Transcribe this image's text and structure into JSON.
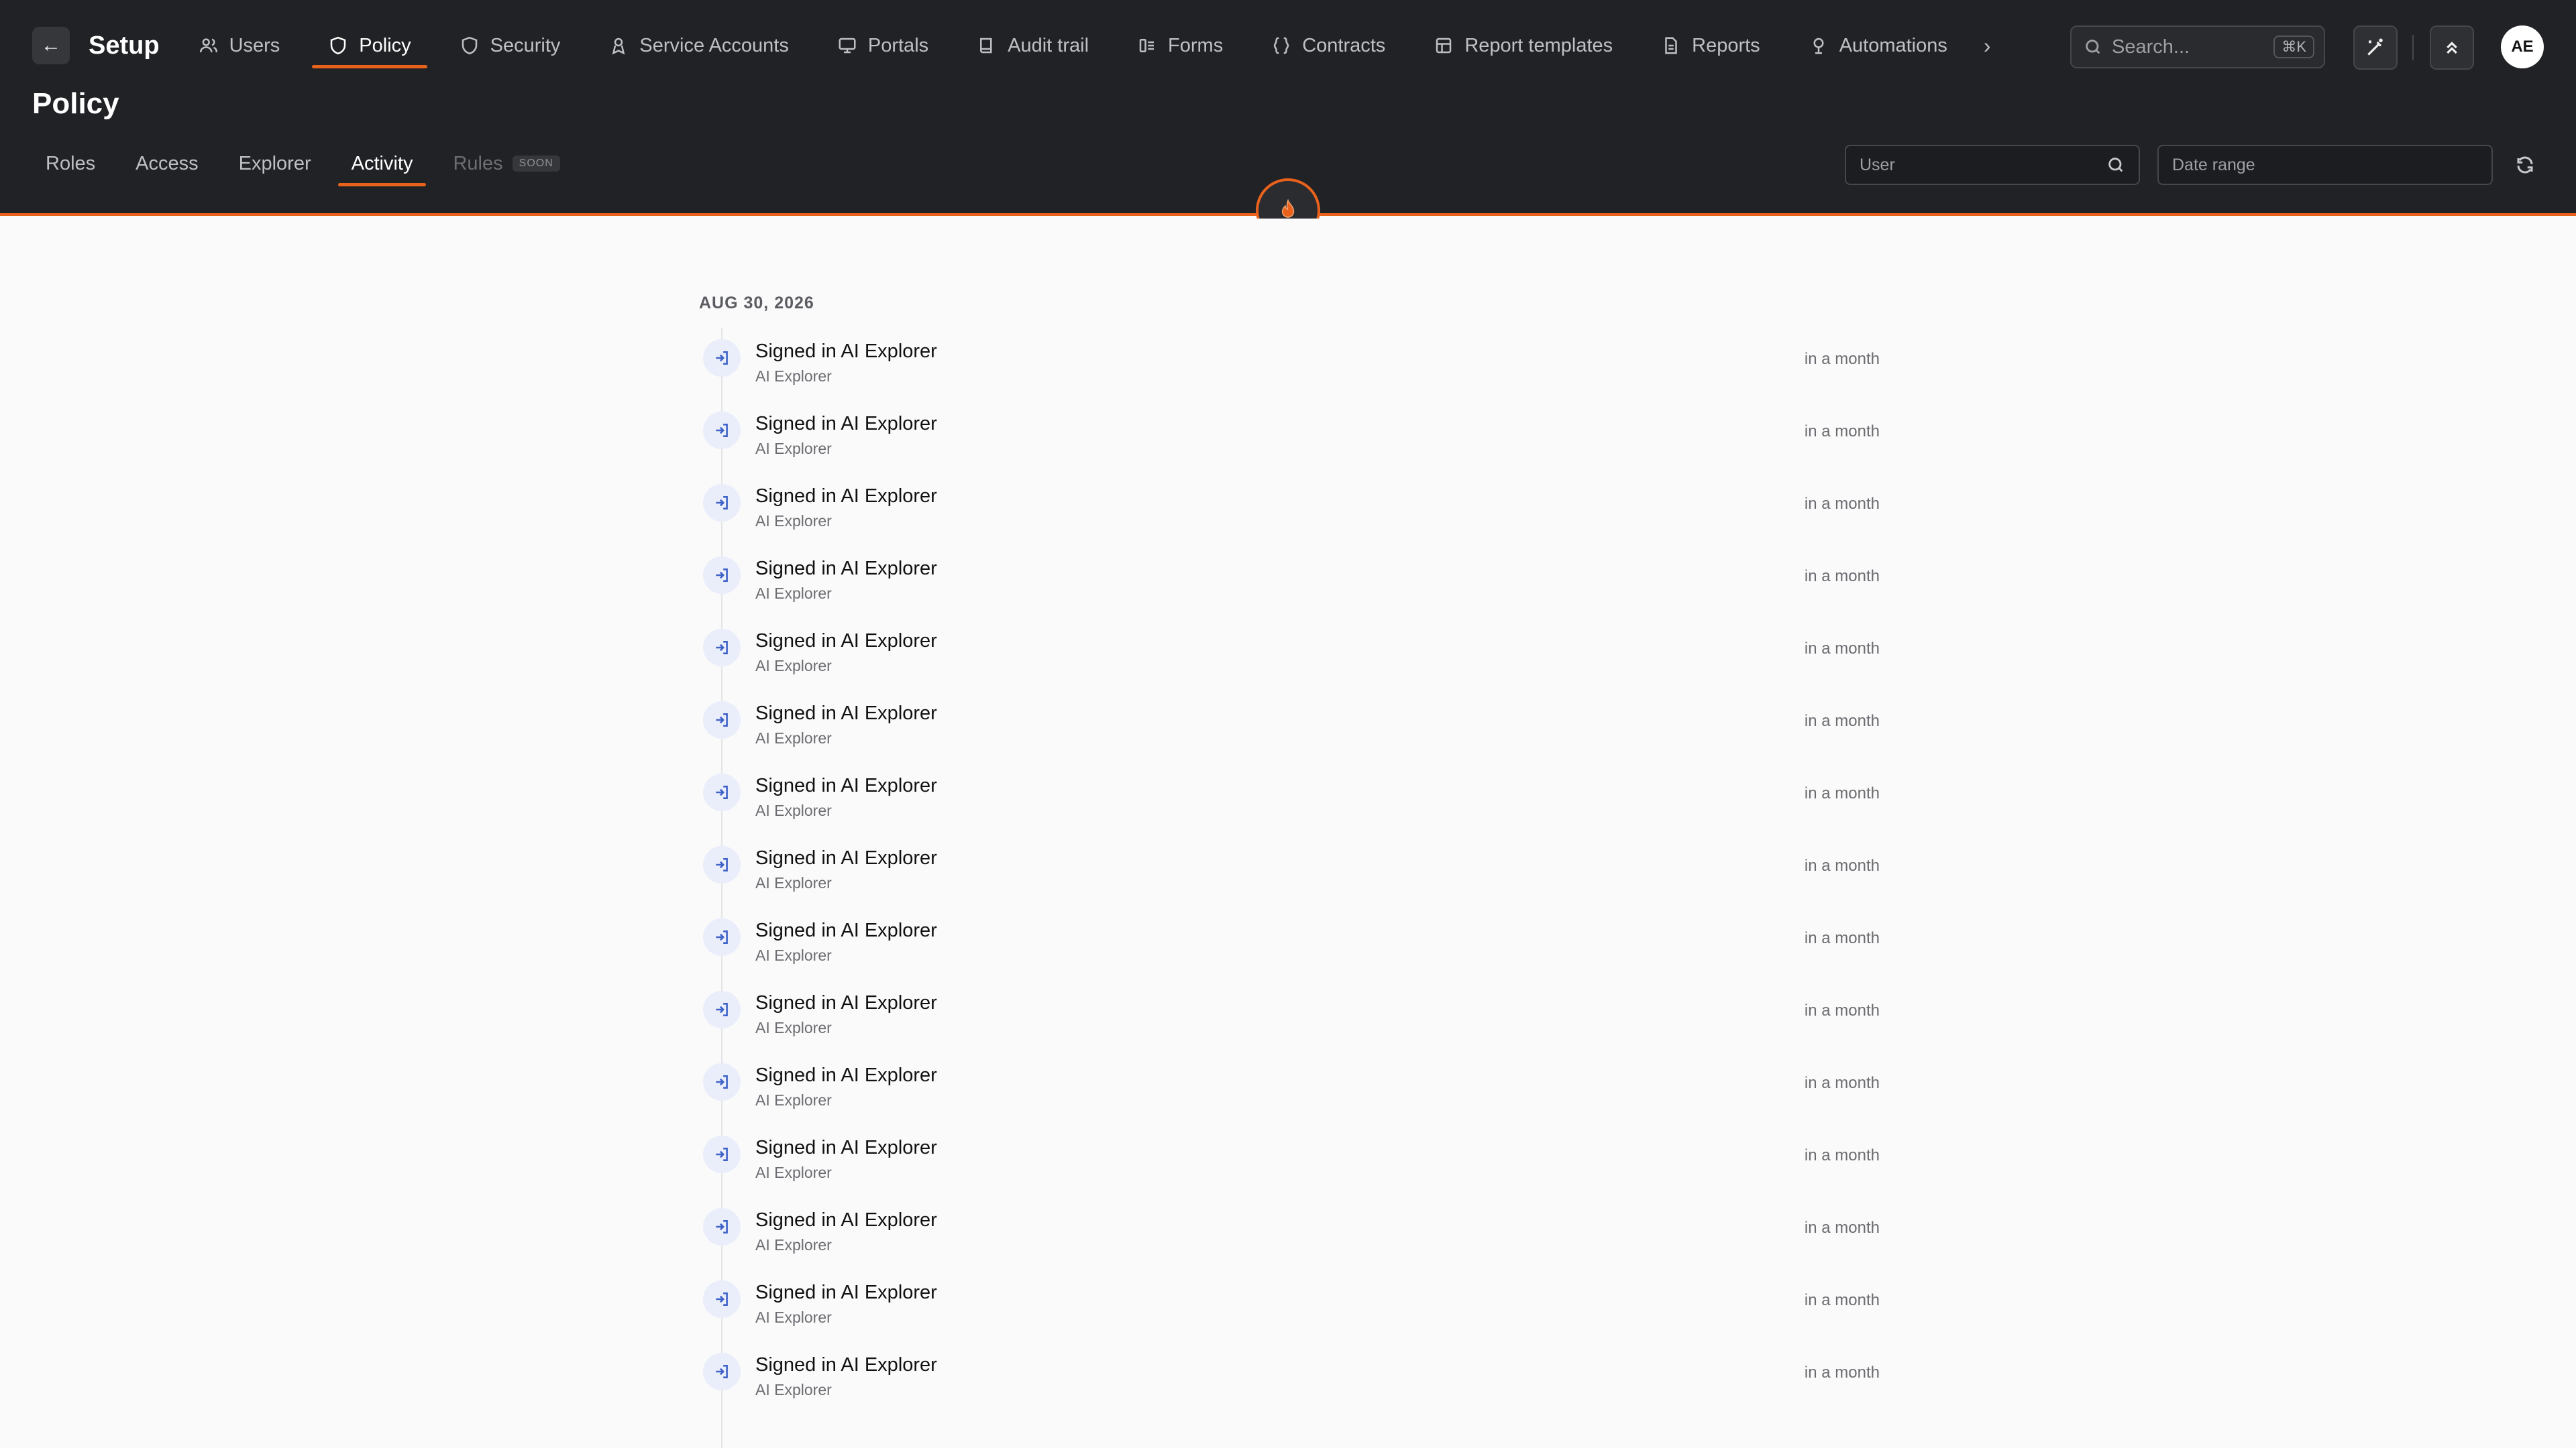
{
  "topbar": {
    "back_label": "←",
    "title": "Setup",
    "nav": [
      {
        "label": "Users",
        "icon": "users-icon"
      },
      {
        "label": "Policy",
        "icon": "shield-icon",
        "active": true
      },
      {
        "label": "Security",
        "icon": "shield-outline-icon"
      },
      {
        "label": "Service Accounts",
        "icon": "service-account-icon"
      },
      {
        "label": "Portals",
        "icon": "monitor-icon"
      },
      {
        "label": "Audit trail",
        "icon": "book-icon"
      },
      {
        "label": "Forms",
        "icon": "forms-icon"
      },
      {
        "label": "Contracts",
        "icon": "braces-icon"
      },
      {
        "label": "Report templates",
        "icon": "template-icon"
      },
      {
        "label": "Reports",
        "icon": "document-icon"
      },
      {
        "label": "Automations",
        "icon": "automation-icon"
      }
    ],
    "more_label": "›",
    "search": {
      "placeholder": "Search...",
      "shortcut": "⌘K"
    },
    "avatar_initials": "AE"
  },
  "page": {
    "title": "Policy",
    "subtabs": [
      {
        "label": "Roles"
      },
      {
        "label": "Access"
      },
      {
        "label": "Explorer"
      },
      {
        "label": "Activity",
        "active": true
      },
      {
        "label": "Rules",
        "disabled": true,
        "badge": "SOON"
      }
    ],
    "filters": {
      "user_placeholder": "User",
      "date_placeholder": "Date range"
    }
  },
  "activity": {
    "date_heading": "AUG 30, 2026",
    "items": [
      {
        "title": "Signed in AI Explorer",
        "subtitle": "AI Explorer",
        "time": "in a month"
      },
      {
        "title": "Signed in AI Explorer",
        "subtitle": "AI Explorer",
        "time": "in a month"
      },
      {
        "title": "Signed in AI Explorer",
        "subtitle": "AI Explorer",
        "time": "in a month"
      },
      {
        "title": "Signed in AI Explorer",
        "subtitle": "AI Explorer",
        "time": "in a month"
      },
      {
        "title": "Signed in AI Explorer",
        "subtitle": "AI Explorer",
        "time": "in a month"
      },
      {
        "title": "Signed in AI Explorer",
        "subtitle": "AI Explorer",
        "time": "in a month"
      },
      {
        "title": "Signed in AI Explorer",
        "subtitle": "AI Explorer",
        "time": "in a month"
      },
      {
        "title": "Signed in AI Explorer",
        "subtitle": "AI Explorer",
        "time": "in a month"
      },
      {
        "title": "Signed in AI Explorer",
        "subtitle": "AI Explorer",
        "time": "in a month"
      },
      {
        "title": "Signed in AI Explorer",
        "subtitle": "AI Explorer",
        "time": "in a month"
      },
      {
        "title": "Signed in AI Explorer",
        "subtitle": "AI Explorer",
        "time": "in a month"
      },
      {
        "title": "Signed in AI Explorer",
        "subtitle": "AI Explorer",
        "time": "in a month"
      },
      {
        "title": "Signed in AI Explorer",
        "subtitle": "AI Explorer",
        "time": "in a month"
      },
      {
        "title": "Signed in AI Explorer",
        "subtitle": "AI Explorer",
        "time": "in a month"
      },
      {
        "title": "Signed in AI Explorer",
        "subtitle": "AI Explorer",
        "time": "in a month"
      }
    ],
    "item_icon": "sign-in-icon"
  },
  "colors": {
    "header_bg": "#212225",
    "accent": "#e8621c",
    "content_bg": "#fafafa",
    "activity_icon": "#3f63c7"
  }
}
